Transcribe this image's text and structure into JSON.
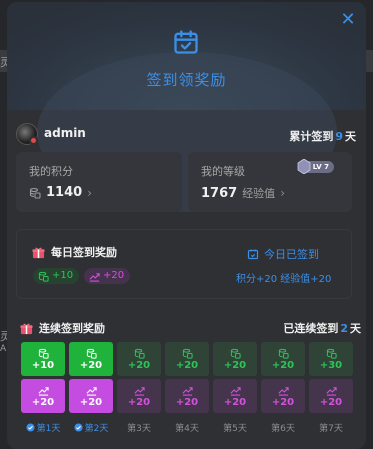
{
  "modal": {
    "title": "签到领奖励",
    "close_label": "✕"
  },
  "user": {
    "name": "admin",
    "cumulative_prefix": "累计签到",
    "cumulative_days": "9",
    "cumulative_suffix": "天"
  },
  "stats": {
    "points_label": "我的积分",
    "points_value": "1140",
    "level_label": "我的等级",
    "level_value": "1767",
    "level_unit": "经验值",
    "level_badge": "LV 7"
  },
  "daily": {
    "title": "每日签到奖励",
    "points_reward": "+10",
    "xp_reward": "+20",
    "status": "今日已签到",
    "summary": "积分+20 经验值+20"
  },
  "streak": {
    "title": "连续签到奖励",
    "status_prefix": "已连续签到",
    "status_days": "2",
    "status_suffix": "天",
    "days": [
      {
        "points": "+10",
        "xp": "+20",
        "label": "第1天",
        "done": true
      },
      {
        "points": "+20",
        "xp": "+20",
        "label": "第2天",
        "done": true
      },
      {
        "points": "+20",
        "xp": "+20",
        "label": "第3天",
        "done": false
      },
      {
        "points": "+20",
        "xp": "+20",
        "label": "第4天",
        "done": false
      },
      {
        "points": "+20",
        "xp": "+20",
        "label": "第5天",
        "done": false
      },
      {
        "points": "+20",
        "xp": "+20",
        "label": "第6天",
        "done": false
      },
      {
        "points": "+30",
        "xp": "+20",
        "label": "第7天",
        "done": false
      }
    ]
  },
  "background": {
    "left_char_1": "灵",
    "left_char_2": "灵",
    "left_char_3": "A"
  }
}
